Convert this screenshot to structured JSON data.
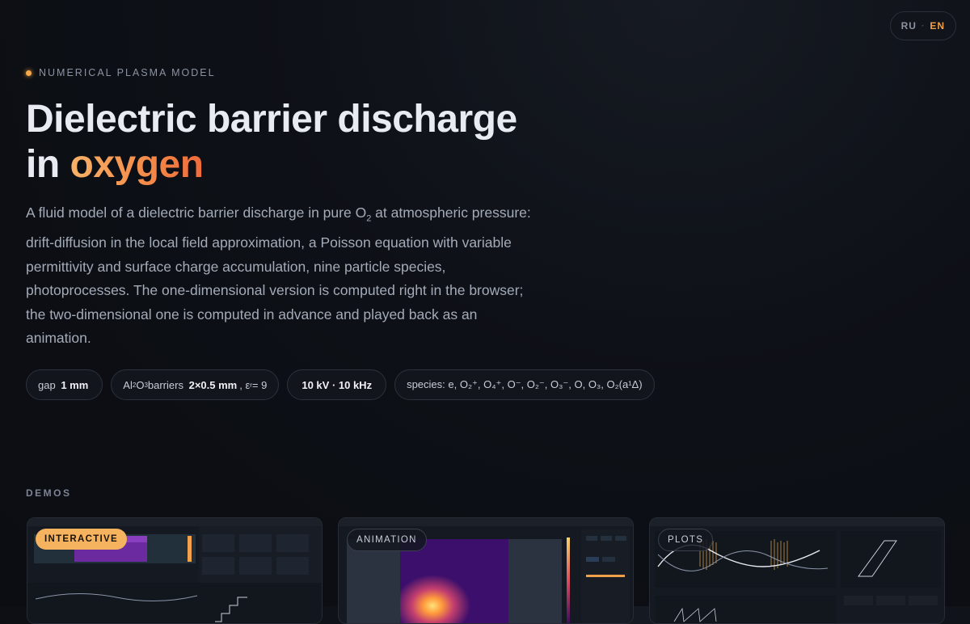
{
  "lang": {
    "ru": "RU",
    "en": "EN"
  },
  "eyebrow": "NUMERICAL PLASMA MODEL",
  "title": {
    "line1": "Dielectric barrier discharge",
    "prefix": "in ",
    "accent": "oxygen"
  },
  "description": {
    "part1": "A fluid model of a dielectric barrier discharge in pure O",
    "sub": "2",
    "part2": " at atmospheric pressure: drift-diffusion in the local field approximation, a Poisson equation with variable permittivity and surface charge accumulation, nine particle species, photoprocesses. The one-dimensional version is computed right in the browser; the two-dimensional one is computed in advance and played back as an animation."
  },
  "chips": {
    "gap": {
      "label": "gap",
      "value": "1 mm"
    },
    "barrier": {
      "material_pre": "Al",
      "m_sub1": "2",
      "material_mid": "O",
      "m_sub2": "3",
      "label": " barriers",
      "value": "2×0.5 mm",
      "eps": ", ε",
      "eps_sub": "r",
      "eps_val": " = 9"
    },
    "source": {
      "value": "10 kV · 10 kHz"
    },
    "species": "species: e, O₂⁺, O₄⁺, O⁻, O₂⁻, O₃⁻, O, O₃, O₂(a¹Δ)"
  },
  "demos_label": "DEMOS",
  "cards": [
    {
      "badge": "INTERACTIVE"
    },
    {
      "badge": "ANIMATION"
    },
    {
      "badge": "PLOTS"
    }
  ],
  "colors": {
    "accent": "#f6b35f",
    "accent_text": "#f48c4a",
    "bg": "#0d1016"
  }
}
